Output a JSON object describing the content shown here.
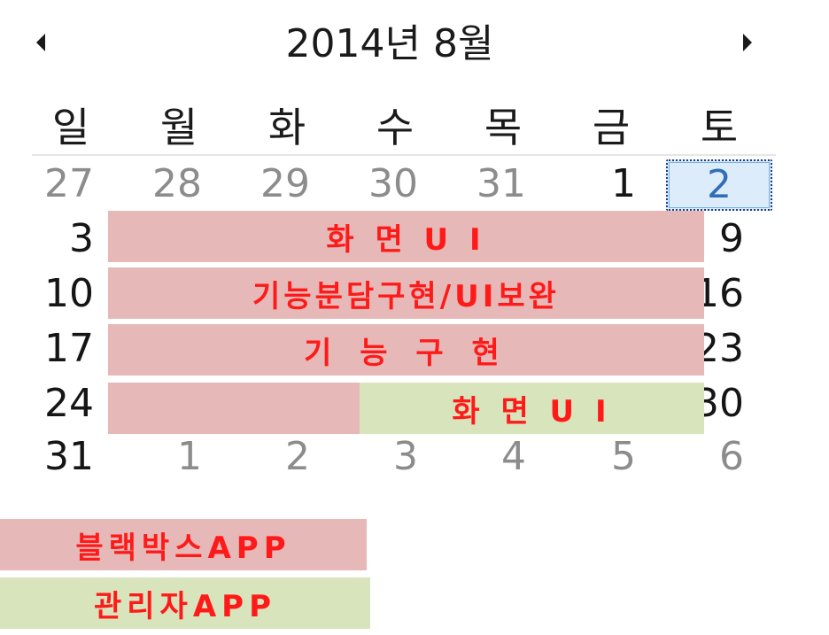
{
  "calendar": {
    "title": "2014년 8월",
    "weekdays": [
      "일",
      "월",
      "화",
      "수",
      "목",
      "금",
      "토"
    ],
    "rows": [
      [
        "27",
        "28",
        "29",
        "30",
        "31",
        "1",
        "2"
      ],
      [
        "3",
        "",
        "",
        "",
        "",
        "",
        "9"
      ],
      [
        "10",
        "",
        "",
        "",
        "",
        "",
        "16"
      ],
      [
        "17",
        "",
        "",
        "",
        "",
        "",
        "23"
      ],
      [
        "24",
        "",
        "",
        "",
        "",
        "",
        "30"
      ],
      [
        "31",
        "1",
        "2",
        "3",
        "4",
        "5",
        "6"
      ]
    ],
    "selected_day": "2"
  },
  "overlays": {
    "row1_label": "화  면 U I",
    "row2_label": "기능분담구현/UI보완",
    "row3_label": "기 능 구 현",
    "row4_label": "화  면 U I"
  },
  "legend": {
    "blackbox": "블랙박스APP",
    "admin": "관리자APP"
  },
  "colors": {
    "blackbox": "#e6b8b7",
    "admin": "#d8e4bc",
    "label_text": "#ff1a1a"
  }
}
